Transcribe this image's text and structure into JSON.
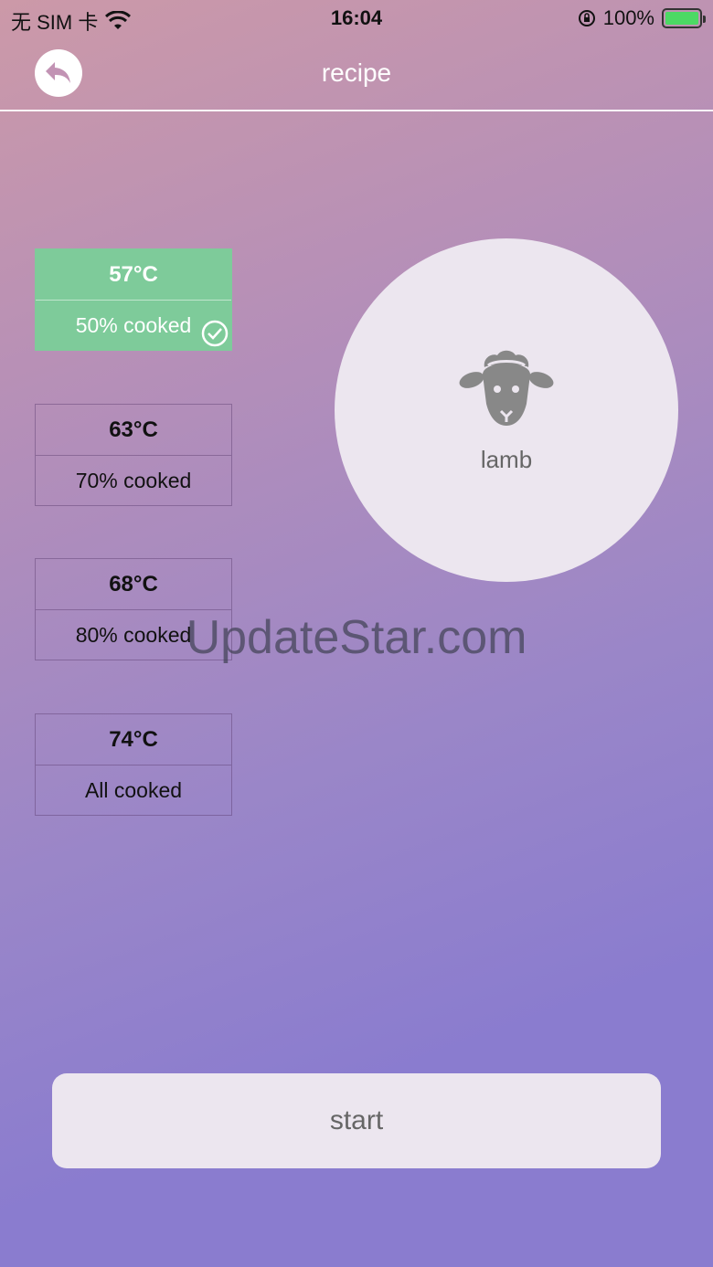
{
  "status_bar": {
    "carrier": "无 SIM 卡",
    "time": "16:04",
    "battery": "100%"
  },
  "nav": {
    "title": "recipe"
  },
  "options": [
    {
      "temp": "57°C",
      "level": "50% cooked",
      "selected": true
    },
    {
      "temp": "63°C",
      "level": "70% cooked",
      "selected": false
    },
    {
      "temp": "68°C",
      "level": "80% cooked",
      "selected": false
    },
    {
      "temp": "74°C",
      "level": "All cooked",
      "selected": false
    }
  ],
  "meat": {
    "label": "lamb",
    "icon": "sheep-icon"
  },
  "watermark": "UpdateStar.com",
  "start_label": "start",
  "colors": {
    "selected": "#7ecb9a",
    "card": "#ece6ef"
  }
}
